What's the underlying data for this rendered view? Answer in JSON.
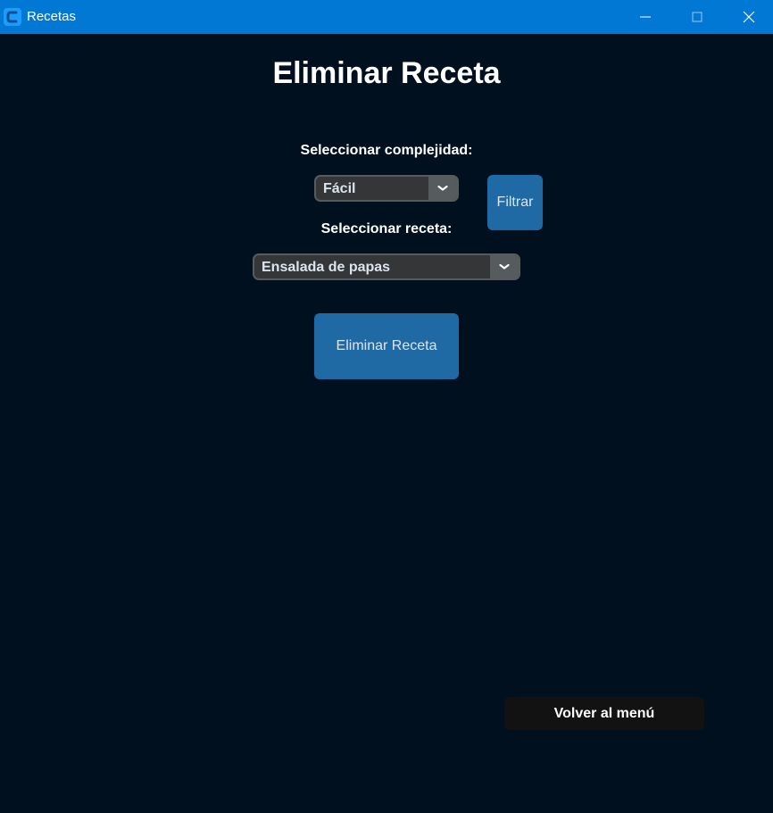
{
  "window": {
    "title": "Recetas",
    "app_icon": "customtkinter-logo-icon",
    "titlebar_color": "#0078d4"
  },
  "main": {
    "heading": "Eliminar Receta",
    "complexity_label": "Seleccionar complejidad:",
    "complexity_value": "Fácil",
    "filter_button": "Filtrar",
    "recipe_label": "Seleccionar receta:",
    "recipe_value": "Ensalada de papas",
    "delete_button": "Eliminar Receta",
    "back_button": "Volver al menú"
  },
  "colors": {
    "background": "#00101f",
    "accent_button": "#1f6aa5",
    "combo_background": "#343638",
    "combo_border": "#565b5e",
    "back_button": "#121212"
  }
}
